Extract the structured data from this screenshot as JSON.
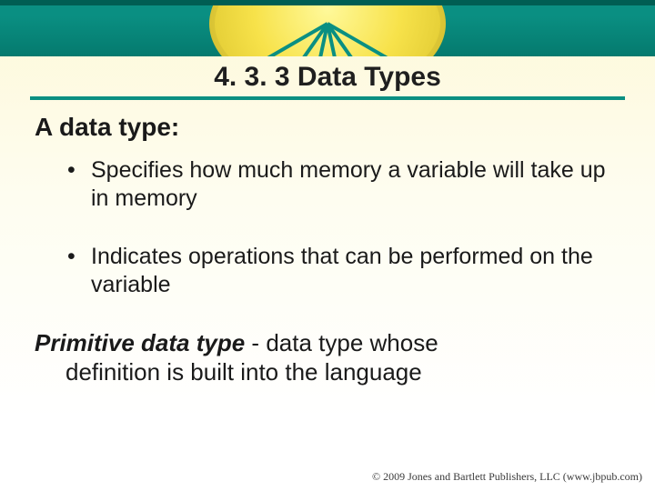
{
  "title": "4. 3. 3 Data Types",
  "subheading": "A data type:",
  "bullets": [
    "Specifies how much memory a variable will take up in memory",
    "Indicates operations that can be performed  on the variable"
  ],
  "definition": {
    "term": "Primitive data type",
    "separator": " - ",
    "body_line1": "data type whose",
    "body_line2": "definition is built into the language"
  },
  "footer": "© 2009 Jones and Bartlett Publishers, LLC (www.jbpub.com)"
}
